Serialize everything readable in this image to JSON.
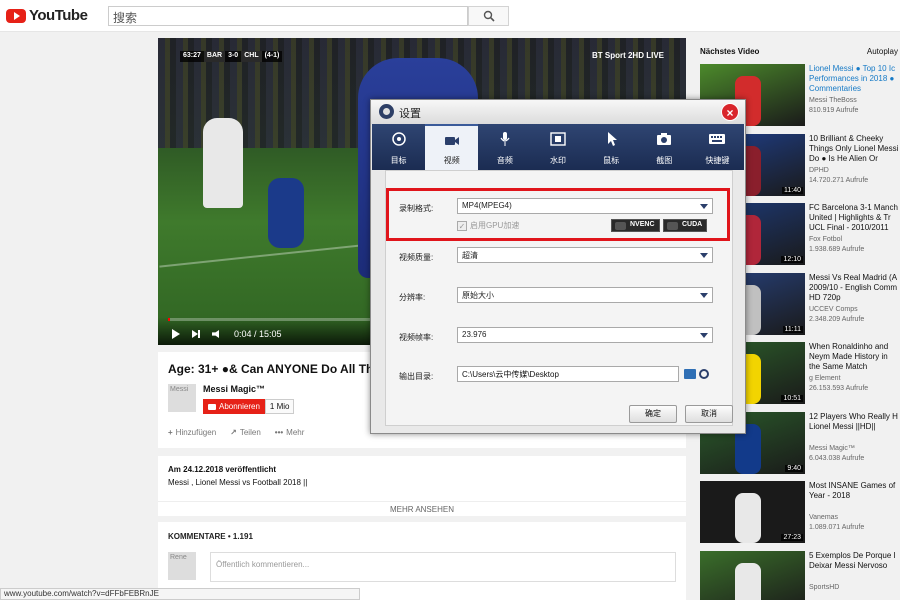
{
  "header": {
    "logo_text": "YouTube",
    "search_placeholder": "搜索",
    "search_icon": "search-icon"
  },
  "player": {
    "scorebug": {
      "time": "63:27",
      "home": "BAR",
      "score": "3-0",
      "away": "CHL",
      "aggregate": "(4-1)"
    },
    "broadcaster": "BT Sport 2HD LIVE",
    "time_display": "0:04 / 15:05",
    "progress": 0.0044
  },
  "video": {
    "title": "Age: 31+ ●& Can ANYONE Do All Thes",
    "channel": "Messi Magic™",
    "avatar_alt": "Messi",
    "subscribe_label": "Abonnieren",
    "subscriber_count": "1 Mio",
    "actions": [
      "Hinzufügen",
      "Teilen",
      "Mehr"
    ],
    "published": "Am 24.12.2018 veröffentlicht",
    "description": "Messi , Lionel Messi vs Football 2018 ||",
    "show_more": "MEHR ANSEHEN"
  },
  "comments": {
    "header": "KOMMENTARE • 1.191",
    "avatar_alt": "Rene",
    "placeholder": "Öffentlich kommentieren..."
  },
  "statusbar": {
    "url": "www.youtube.com/watch?v=dFFbFEBRnJE"
  },
  "sidebar": {
    "next_label": "Nächstes Video",
    "autoplay_label": "Autoplay",
    "items": [
      {
        "title": "Lionel Messi ● Top 10 Ic Performances in 2018 ● Commentaries",
        "channel": "Messi TheBoss",
        "views": "810.919 Aufrufe",
        "duration": "",
        "link": true
      },
      {
        "title": "10 Brilliant & Cheeky Things Only Lionel Messi Do ● Is He Alien Or Human",
        "channel": "DPHD",
        "views": "14.720.271 Aufrufe",
        "duration": "11:40",
        "link": false
      },
      {
        "title": "FC Barcelona 3-1 Manch United | Highlights & Tr UCL Final - 2010/2011",
        "channel": "Fox Fotbol",
        "views": "1.938.689 Aufrufe",
        "duration": "12:10",
        "link": false
      },
      {
        "title": "Messi Vs Real Madrid (A 2009/10 - English Comm HD 720p",
        "channel": "UCCEV Comps",
        "views": "2.348.209 Aufrufe",
        "duration": "11:11",
        "link": false
      },
      {
        "title": "When Ronaldinho and Neym Made History in the Same Match",
        "channel": "g Element",
        "views": "26.153.593 Aufrufe",
        "duration": "10:51",
        "link": false
      },
      {
        "title": "12 Players Who Really H Lionel Messi ||HD||",
        "channel": "Messi Magic™",
        "views": "6.043.038 Aufrufe",
        "duration": "9:40",
        "link": false
      },
      {
        "title": "Most INSANE Games of Year - 2018",
        "channel": "Vanemas",
        "views": "1.089.071 Aufrufe",
        "duration": "27:23",
        "link": false
      },
      {
        "title": "5 Exemplos De Porque I Deixar Messi Nervoso",
        "channel": "SportsHD",
        "views": "",
        "duration": "",
        "link": false
      }
    ]
  },
  "dialog": {
    "title": "设置",
    "close": "×",
    "tabs": [
      {
        "label": "目标",
        "icon": "target-icon"
      },
      {
        "label": "视频",
        "icon": "video-camera-icon"
      },
      {
        "label": "音频",
        "icon": "microphone-icon"
      },
      {
        "label": "水印",
        "icon": "watermark-icon"
      },
      {
        "label": "鼠标",
        "icon": "cursor-icon"
      },
      {
        "label": "截图",
        "icon": "camera-icon"
      },
      {
        "label": "快捷键",
        "icon": "keyboard-icon"
      }
    ],
    "active_tab": 1,
    "format_label": "录制格式:",
    "format_value": "MP4(MPEG4)",
    "gpu_label": "启用GPU加速",
    "nvenc": "NVENC",
    "cuda": "CUDA",
    "quality_label": "视频质量:",
    "quality_value": "超清",
    "resolution_label": "分辨率:",
    "resolution_value": "原始大小",
    "framerate_label": "视频帧率:",
    "framerate_value": "23.976",
    "output_label": "输出目录:",
    "output_value": "C:\\Users\\云中传媒\\Desktop",
    "ok_label": "确定",
    "cancel_label": "取消",
    "highlight_color": "#e0151b"
  }
}
